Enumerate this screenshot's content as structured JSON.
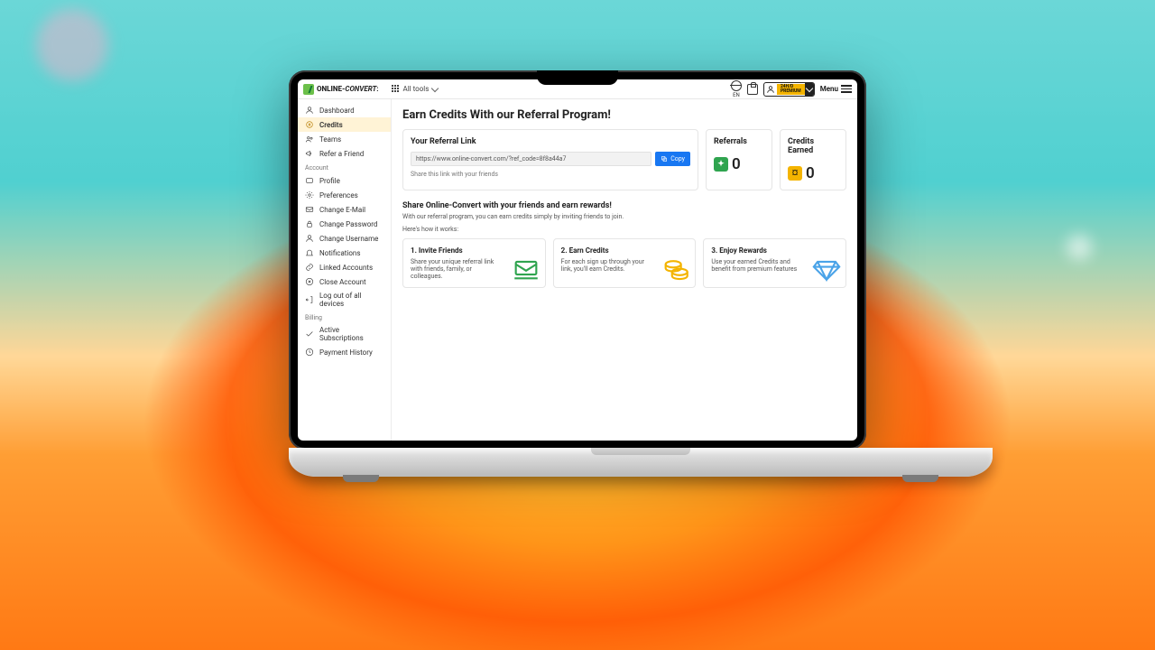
{
  "brand": {
    "first": "ONLINE-",
    "second": "CONVERT",
    "suffix": ":"
  },
  "header": {
    "all_tools": "All tools",
    "lang": "EN",
    "badge_top": "24H/D",
    "badge_bottom": "PREMIUM",
    "menu": "Menu"
  },
  "sidebar": {
    "items": [
      {
        "label": "Dashboard"
      },
      {
        "label": "Credits"
      },
      {
        "label": "Teams"
      },
      {
        "label": "Refer a Friend"
      }
    ],
    "account_heading": "Account",
    "account": [
      {
        "label": "Profile"
      },
      {
        "label": "Preferences"
      },
      {
        "label": "Change E-Mail"
      },
      {
        "label": "Change Password"
      },
      {
        "label": "Change Username"
      },
      {
        "label": "Notifications"
      },
      {
        "label": "Linked Accounts"
      },
      {
        "label": "Close Account"
      },
      {
        "label": "Log out of all devices"
      }
    ],
    "billing_heading": "Billing",
    "billing": [
      {
        "label": "Active Subscriptions"
      },
      {
        "label": "Payment History"
      }
    ]
  },
  "page": {
    "title": "Earn Credits With our Referral Program!",
    "link_heading": "Your Referral Link",
    "link_value": "https://www.online-convert.com/?ref_code=8f8a44a7",
    "copy": "Copy",
    "hint": "Share this link with your friends",
    "referrals_label": "Referrals",
    "referrals_value": "0",
    "credits_label": "Credits Earned",
    "credits_value": "0",
    "share_heading": "Share Online-Convert with your friends and earn rewards!",
    "share_sub": "With our referral program, you can earn credits simply by inviting friends to join.",
    "how": "Here's how it works:",
    "steps": [
      {
        "title": "1. Invite Friends",
        "desc": "Share your unique referral link with friends, family, or colleagues."
      },
      {
        "title": "2. Earn Credits",
        "desc": "For each sign up through your link, you'll earn Credits."
      },
      {
        "title": "3. Enjoy Rewards",
        "desc": "Use your earned Credits and benefit from premium features"
      }
    ]
  }
}
